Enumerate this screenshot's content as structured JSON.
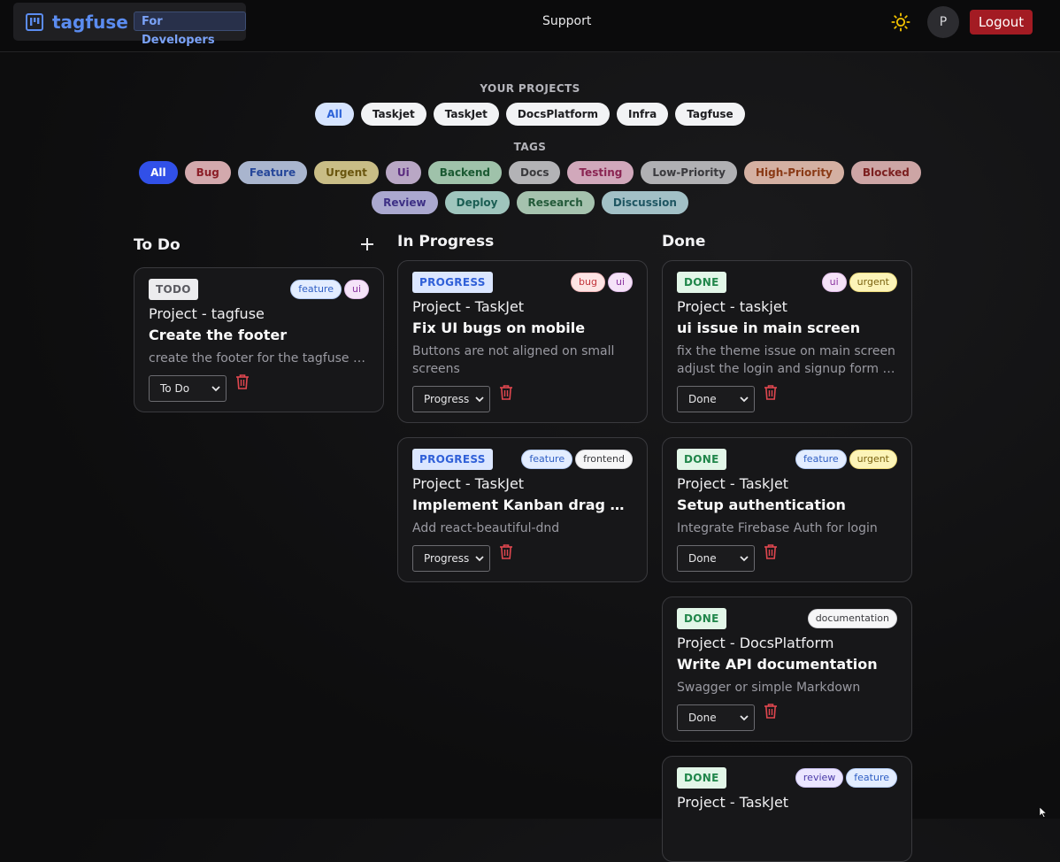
{
  "brand": {
    "name": "tagfuse",
    "badge": "For Developers"
  },
  "nav": {
    "support": "Support",
    "avatar_initial": "P",
    "logout": "Logout"
  },
  "projects": {
    "label": "YOUR PROJECTS",
    "items": [
      "All",
      "Taskjet",
      "TaskJet",
      "DocsPlatform",
      "Infra",
      "Tagfuse"
    ],
    "active": "All"
  },
  "tags": {
    "label": "TAGS",
    "row1": [
      {
        "label": "All",
        "bg": "#3150e8",
        "fg": "#ffffff",
        "border": "#3150e8"
      },
      {
        "label": "Bug",
        "bg": "#d3a9ad",
        "fg": "#8c1f28",
        "border": "#d3a9ad"
      },
      {
        "label": "Feature",
        "bg": "#a9b5ce",
        "fg": "#26479a",
        "border": "#a9b5ce"
      },
      {
        "label": "Urgent",
        "bg": "#c9bd86",
        "fg": "#6a560f",
        "border": "#c9bd86"
      },
      {
        "label": "Ui",
        "bg": "#b9a7c5",
        "fg": "#5b2d80",
        "border": "#b9a7c5"
      },
      {
        "label": "Backend",
        "bg": "#9fc2aa",
        "fg": "#1b5a33",
        "border": "#9fc2aa"
      },
      {
        "label": "Docs",
        "bg": "#b3b3b6",
        "fg": "#3a3a3e",
        "border": "#b3b3b6"
      },
      {
        "label": "Testing",
        "bg": "#d1a8bb",
        "fg": "#8a2452",
        "border": "#d1a8bb"
      },
      {
        "label": "Low-Priority",
        "bg": "#b0b0b3",
        "fg": "#3a3a3e",
        "border": "#b0b0b3"
      },
      {
        "label": "High-Priority",
        "bg": "#d4b0a2",
        "fg": "#8a3a16",
        "border": "#d4b0a2"
      },
      {
        "label": "Blocked",
        "bg": "#cda5a5",
        "fg": "#7c2020",
        "border": "#cda5a5"
      }
    ],
    "row2": [
      {
        "label": "Review",
        "bg": "#aaa8cf",
        "fg": "#3d2f85",
        "border": "#aaa8cf"
      },
      {
        "label": "Deploy",
        "bg": "#9fc5bd",
        "fg": "#1b5e54",
        "border": "#9fc5bd"
      },
      {
        "label": "Research",
        "bg": "#a5c2ae",
        "fg": "#245a3a",
        "border": "#a5c2ae"
      },
      {
        "label": "Discussion",
        "bg": "#a2c0c6",
        "fg": "#1f5662",
        "border": "#a2c0c6"
      }
    ]
  },
  "columns": {
    "todo": "To Do",
    "progress": "In Progress",
    "done": "Done"
  },
  "tag_styles": {
    "feature": {
      "bg": "#e3edff",
      "fg": "#2f5fc4",
      "border": "#b4cbf5"
    },
    "ui": {
      "bg": "#f5e3f8",
      "fg": "#8a34a0",
      "border": "#e0bce8"
    },
    "bug": {
      "bg": "#fde4e4",
      "fg": "#c2333a",
      "border": "#f2b6b8"
    },
    "urgent": {
      "bg": "#fcf4b8",
      "fg": "#7a6310",
      "border": "#ecd97a"
    },
    "frontend": {
      "bg": "#f6f6f7",
      "fg": "#3a3a3e",
      "border": "#d4d4d8"
    },
    "documentation": {
      "bg": "#f6f6f7",
      "fg": "#3a3a3e",
      "border": "#d4d4d8"
    },
    "review": {
      "bg": "#ebe6ff",
      "fg": "#4a3aa8",
      "border": "#c8bff0"
    }
  },
  "cards": [
    {
      "status": "TODO",
      "tags": [
        "feature",
        "ui"
      ],
      "project": "Project - tagfuse",
      "title": "Create the footer",
      "desc": [
        "create the footer for the tagfuse app"
      ],
      "select": "To Do"
    },
    {
      "status": "PROGRESS",
      "tags": [
        "bug",
        "ui"
      ],
      "project": "Project - TaskJet",
      "title": "Fix UI bugs on mobile",
      "desc": [
        "Buttons are not aligned on small",
        "screens"
      ],
      "select": "Progress"
    },
    {
      "status": "PROGRESS",
      "tags": [
        "feature",
        "frontend"
      ],
      "project": "Project - TaskJet",
      "title": "Implement Kanban drag and drop",
      "desc": [
        "Add react-beautiful-dnd"
      ],
      "select": "Progress"
    },
    {
      "status": "DONE",
      "tags": [
        "ui",
        "urgent"
      ],
      "project": "Project - taskjet",
      "title": "ui issue in main screen",
      "desc": [
        "fix the theme issue on main screen",
        "adjust the login and signup form to fit"
      ],
      "select": "Done"
    },
    {
      "status": "DONE",
      "tags": [
        "feature",
        "urgent"
      ],
      "project": "Project - TaskJet",
      "title": "Setup authentication",
      "desc": [
        "Integrate Firebase Auth for login"
      ],
      "select": "Done"
    },
    {
      "status": "DONE",
      "tags": [
        "documentation"
      ],
      "project": "Project - DocsPlatform",
      "title": "Write API documentation",
      "desc": [
        "Swagger or simple Markdown"
      ],
      "select": "Done"
    },
    {
      "status": "DONE",
      "tags": [
        "review",
        "feature"
      ],
      "project": "Project - TaskJet",
      "title": "",
      "desc": [],
      "select": ""
    }
  ]
}
